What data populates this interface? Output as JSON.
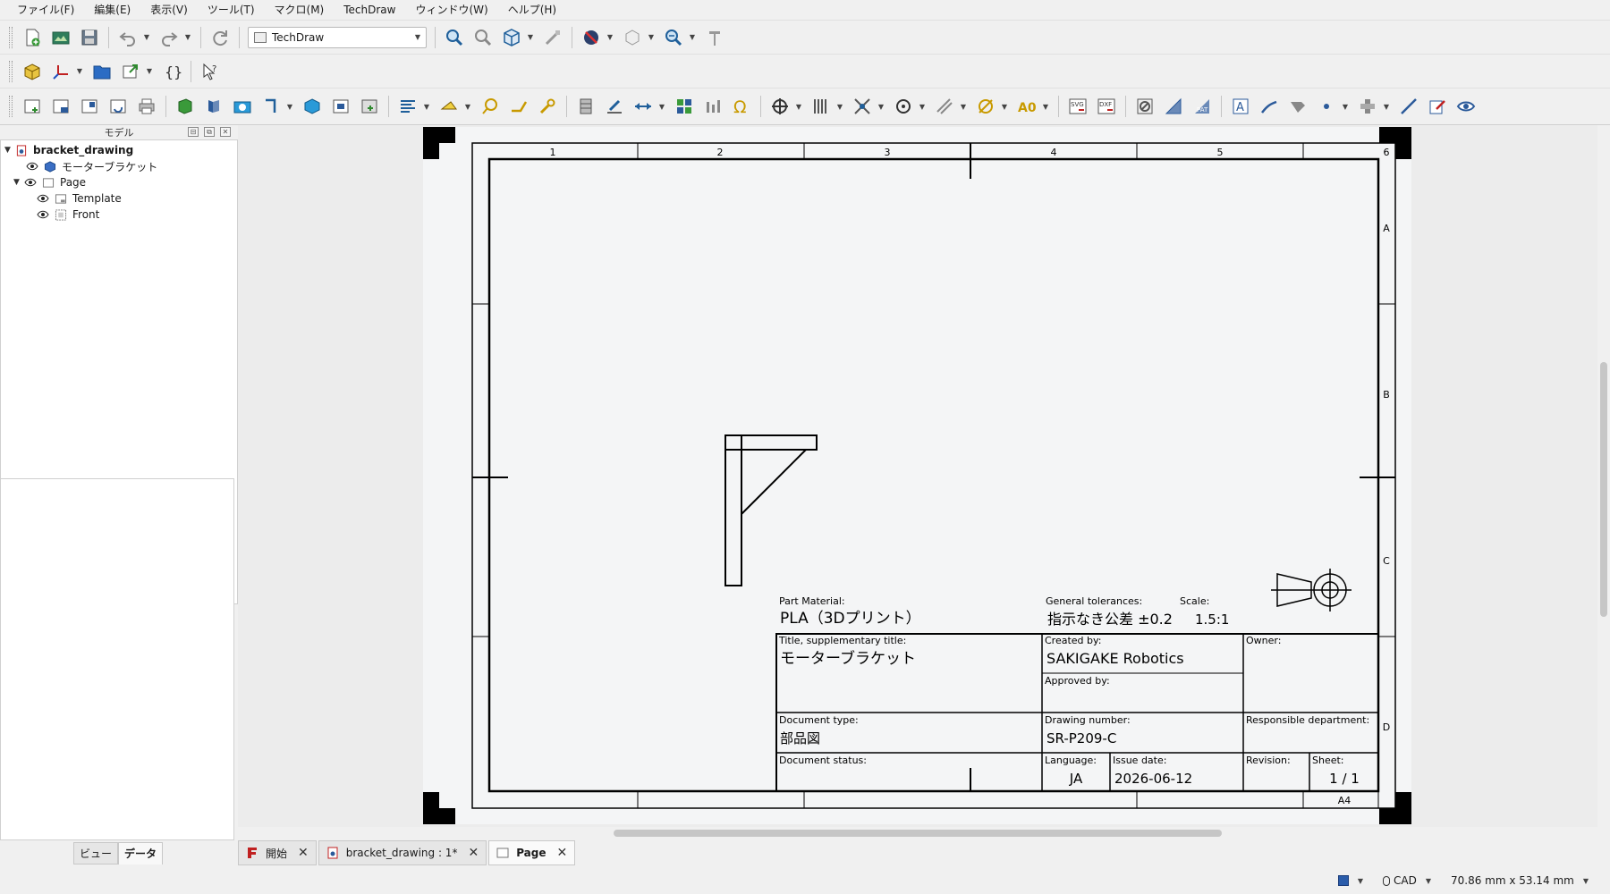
{
  "menu": [
    "ファイル(F)",
    "編集(E)",
    "表示(V)",
    "ツール(T)",
    "マクロ(M)",
    "TechDraw",
    "ウィンドウ(W)",
    "ヘルプ(H)"
  ],
  "toolbar": {
    "workbench": "TechDraw"
  },
  "panel": {
    "title": "モデル",
    "tabs": [
      "ビュー",
      "データ"
    ],
    "tree": {
      "document": "bracket_drawing",
      "items": [
        {
          "label": "モーターブラケット",
          "icon": "part-icon"
        },
        {
          "label": "Page",
          "icon": "page-icon"
        },
        {
          "label": "Template",
          "icon": "template-icon"
        },
        {
          "label": "Front",
          "icon": "view-icon"
        }
      ]
    }
  },
  "sheet": {
    "columns": [
      "1",
      "2",
      "3",
      "4",
      "5",
      "6"
    ],
    "rows": [
      "A",
      "B",
      "C",
      "D"
    ],
    "size": "A4"
  },
  "titleblock": {
    "part_material_label": "Part Material:",
    "part_material": "PLA（3Dプリント）",
    "general_tolerances_label": "General tolerances:",
    "general_tolerances": "指示なき公差 ±0.2",
    "scale_label": "Scale:",
    "scale": "1.5:1",
    "title_label": "Title, supplementary title:",
    "title": "モーターブラケット",
    "created_by_label": "Created by:",
    "created_by": "SAKIGAKE Robotics",
    "owner_label": "Owner:",
    "approved_by_label": "Approved by:",
    "document_type_label": "Document type:",
    "document_type": "部品図",
    "drawing_number_label": "Drawing number:",
    "drawing_number": "SR-P209-C",
    "responsible_department_label": "Responsible department:",
    "document_status_label": "Document status:",
    "language_label": "Language:",
    "language": "JA",
    "issue_date_label": "Issue date:",
    "issue_date": "2026-06-12",
    "revision_label": "Revision:",
    "sheet_label": "Sheet:",
    "sheet": "1 / 1"
  },
  "doc_tabs": [
    {
      "label": "開始",
      "active": false
    },
    {
      "label": "bracket_drawing : 1*",
      "active": false
    },
    {
      "label": "Page",
      "active": true
    }
  ],
  "status": {
    "navigation": "CAD",
    "dimensions": "70.86 mm x 53.14 mm"
  }
}
